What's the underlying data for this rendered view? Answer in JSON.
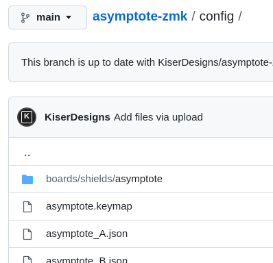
{
  "branch_selector": {
    "label": "main",
    "icon": "git-branch-icon"
  },
  "breadcrumb": {
    "repo": "asymptote-zmk",
    "separator": "/",
    "folder": "config",
    "trailing": "/"
  },
  "status_banner": {
    "text": "This branch is up to date with KiserDesigns/asymptote-zmk:main."
  },
  "latest_commit": {
    "author": "KiserDesigns",
    "message": "Add files via upload",
    "avatar_letter": "K"
  },
  "file_list": {
    "parent_link": "..",
    "folder": {
      "prefix": "boards/shields/",
      "name": "asymptote",
      "icon": "folder-icon"
    },
    "files": [
      {
        "name": "asymptote.keymap",
        "icon": "file-icon"
      },
      {
        "name": "asymptote_A.json",
        "icon": "file-icon"
      },
      {
        "name": "asymptote_B.json",
        "icon": "file-icon"
      }
    ]
  },
  "colors": {
    "link": "#0969da",
    "folder": "#54aeff",
    "border": "#d0d7de",
    "subtle_bg": "#f6f8fa"
  }
}
